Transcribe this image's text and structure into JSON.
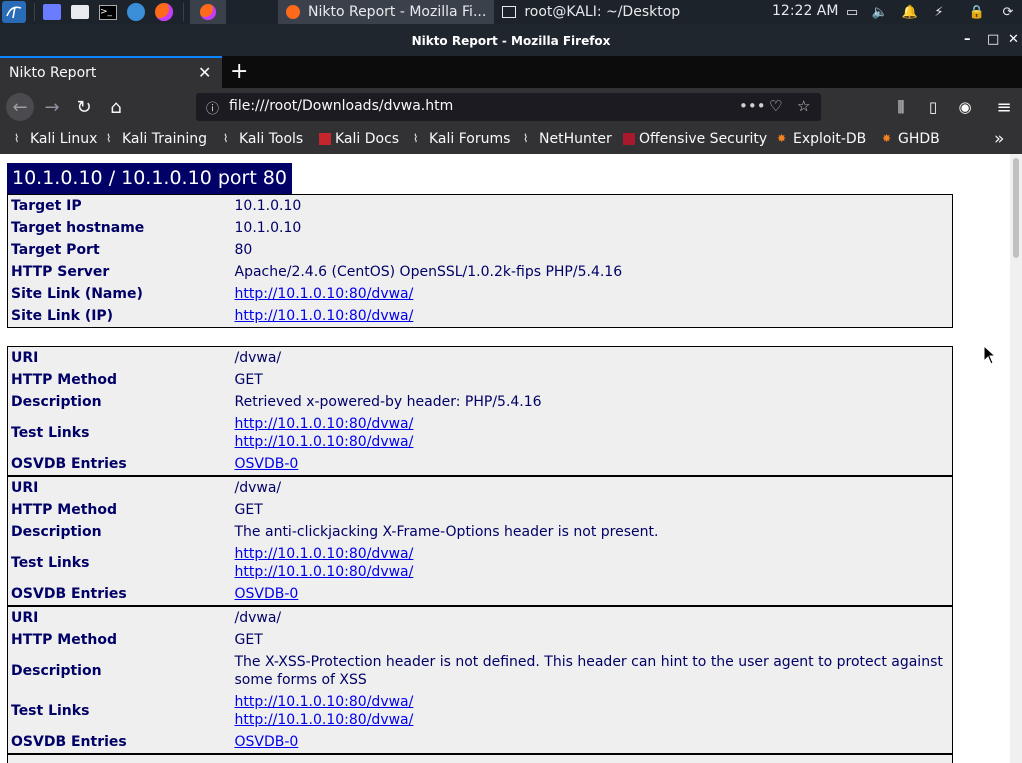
{
  "taskbar": {
    "tasks": [
      {
        "label": "Nikto Report - Mozilla Fi...",
        "active": true
      },
      {
        "label": "root@KALI: ~/Desktop",
        "active": false
      }
    ],
    "clock": "12:22 AM"
  },
  "window": {
    "title": "Nikto Report - Mozilla Firefox"
  },
  "browser": {
    "tab_title": "Nikto Report",
    "url": "file:///root/Downloads/dvwa.htm",
    "bookmarks": [
      "Kali Linux",
      "Kali Training",
      "Kali Tools",
      "Kali Docs",
      "Kali Forums",
      "NetHunter",
      "Offensive Security",
      "Exploit-DB",
      "GHDB"
    ]
  },
  "report": {
    "host_title": "10.1.0.10 / 10.1.0.10 port 80",
    "summary": {
      "target_ip_label": "Target IP",
      "target_ip": "10.1.0.10",
      "hostname_label": "Target hostname",
      "hostname": "10.1.0.10",
      "port_label": "Target Port",
      "port": "80",
      "server_label": "HTTP Server",
      "server": "Apache/2.4.6 (CentOS) OpenSSL/1.0.2k-fips PHP/5.4.16",
      "site_name_label": "Site Link (Name)",
      "site_name": "http://10.1.0.10:80/dvwa/",
      "site_ip_label": "Site Link (IP)",
      "site_ip": "http://10.1.0.10:80/dvwa/"
    },
    "labels": {
      "uri": "URI",
      "method": "HTTP Method",
      "description": "Description",
      "test_links": "Test Links",
      "osvdb": "OSVDB Entries"
    },
    "findings": [
      {
        "uri": "/dvwa/",
        "method": "GET",
        "description": "Retrieved x-powered-by header: PHP/5.4.16",
        "link1": "http://10.1.0.10:80/dvwa/",
        "link2": "http://10.1.0.10:80/dvwa/",
        "osvdb": "OSVDB-0"
      },
      {
        "uri": "/dvwa/",
        "method": "GET",
        "description": "The anti-clickjacking X-Frame-Options header is not present.",
        "link1": "http://10.1.0.10:80/dvwa/",
        "link2": "http://10.1.0.10:80/dvwa/",
        "osvdb": "OSVDB-0"
      },
      {
        "uri": "/dvwa/",
        "method": "GET",
        "description": "The X-XSS-Protection header is not defined. This header can hint to the user agent to protect against some forms of XSS",
        "link1": "http://10.1.0.10:80/dvwa/",
        "link2": "http://10.1.0.10:80/dvwa/",
        "osvdb": "OSVDB-0"
      }
    ]
  }
}
